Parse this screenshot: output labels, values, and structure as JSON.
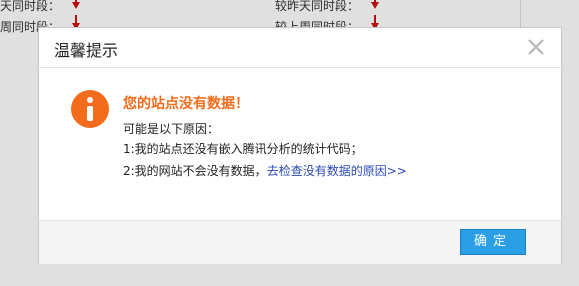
{
  "background": {
    "rows": [
      {
        "left": "天同时段：",
        "right": "较昨天同时段："
      },
      {
        "left": "周同时段：",
        "right": "较上周同时段："
      }
    ]
  },
  "dialog": {
    "title": "温馨提示",
    "headline": "您的站点没有数据！",
    "lines": {
      "reason_intro": "可能是以下原因：",
      "reason_1": "1:我的站点还没有嵌入腾讯分析的统计代码；",
      "reason_2_prefix": "2:我的网站不会没有数据，",
      "reason_2_link": "去检查没有数据的原因>>"
    },
    "ok_label": "确定"
  },
  "colors": {
    "accent_orange": "#f36c1c",
    "primary_blue": "#2b9fe5",
    "link_blue": "#2b49b6",
    "down_arrow_red": "#d01010"
  },
  "icons": {
    "info": "info-icon",
    "close": "close-icon",
    "down_arrow": "down-arrow-icon"
  }
}
